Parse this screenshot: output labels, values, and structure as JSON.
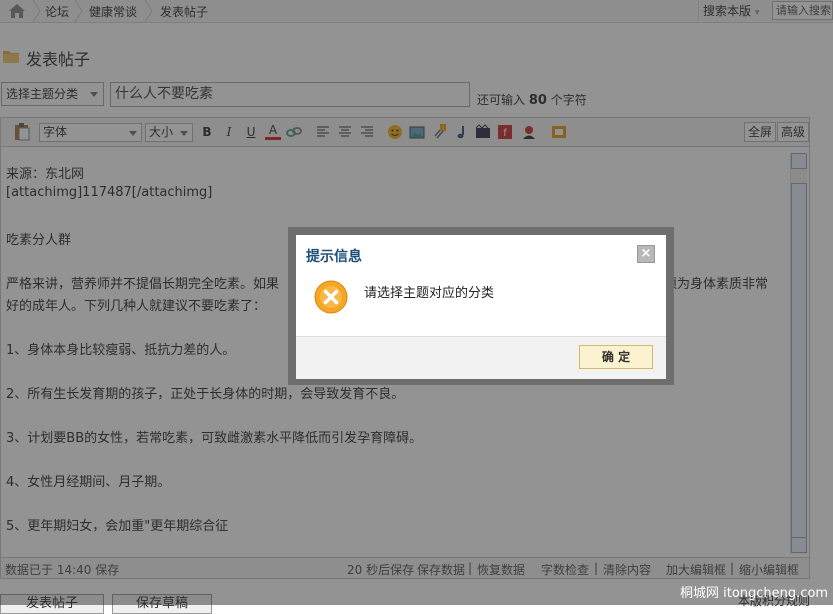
{
  "breadcrumb": {
    "items": [
      "论坛",
      "健康常谈",
      "发表帖子"
    ]
  },
  "nav": {
    "search_scope": "搜索本版",
    "search_placeholder": "请输入搜索"
  },
  "page_title": "发表帖子",
  "category_select": {
    "value": "选择主题分类"
  },
  "subject": {
    "value": "什么人不要吃素"
  },
  "remaining": {
    "prefix": "还可输入",
    "count": "80",
    "suffix": "个字符"
  },
  "toolbar": {
    "font": "字体",
    "size": "大小",
    "bold": "B",
    "italic": "I",
    "underline": "U",
    "font_color": "A",
    "fullscreen": "全屏",
    "advanced": "高级"
  },
  "editor": {
    "lines": [
      "来源：东北网",
      "[attachimg]117487[/attachimg]",
      "吃素分人群",
      "严格来讲，营养师并不提倡长期完全吃素。如果",
      "须为身体素质非常",
      "好的成年人。下列几种人就建议不要吃素了：",
      "1、身体本身比较瘦弱、抵抗力差的人。",
      "2、所有生长发育期的孩子，正处于长身体的时期，会导致发育不良。",
      "3、计划要BB的女性，若常吃素，可致雌激素水平降低而引发孕育障碍。",
      "4、女性月经期间、月子期。",
      "5、更年期妇女，会加重\"更年期综合征"
    ]
  },
  "statusbar": {
    "saved": "数据已于 14:40 保存",
    "autosave": "20 秒后保存",
    "save_data": "保存数据",
    "restore_data": "恢复数据",
    "word_check": "字数检查",
    "clear_content": "清除内容",
    "enlarge_editor": "加大编辑框",
    "shrink_editor": "缩小编辑框",
    "separator": "|"
  },
  "buttons": {
    "submit": "发表帖子",
    "draft": "保存草稿",
    "rules": "本版积分规则"
  },
  "watermark": "桐城网 itongcheng.com",
  "dialog": {
    "title": "提示信息",
    "close": "×",
    "message": "请选择主题对应的分类",
    "ok": "确 定"
  },
  "colors": {
    "dialog_title": "#1f4e79",
    "ok_button_bg": "#fbf2cf",
    "error_icon": "#f5a623"
  }
}
